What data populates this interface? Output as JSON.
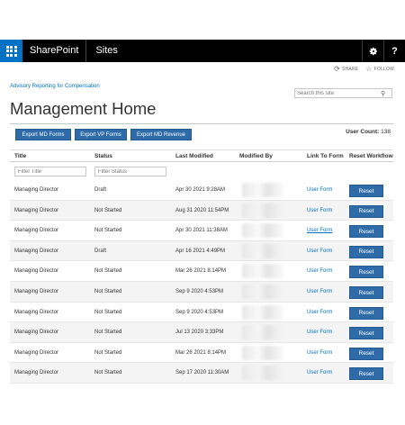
{
  "suitebar": {
    "brand": "SharePoint",
    "sites": "Sites",
    "gear_icon": "gear-icon",
    "help_label": "?"
  },
  "actions": {
    "share": "SHARE",
    "follow": "FOLLOW"
  },
  "site_link": "Advisory Reporting for Compensation",
  "search": {
    "placeholder": "Search this site"
  },
  "page_title": "Management Home",
  "buttons": {
    "export_md": "Export MD Forms",
    "export_vp": "Export VP Forms",
    "export_rev": "Export MD Revenue"
  },
  "user_count": {
    "label": "User Count:",
    "value": "138"
  },
  "columns": {
    "title": "Title",
    "status": "Status",
    "modified": "Last Modified",
    "modified_by": "Modified By",
    "link": "Link To Form",
    "reset": "Reset Workflow"
  },
  "filters": {
    "title": "Filter Title",
    "status": "Filter Status"
  },
  "rows": [
    {
      "title": "Managing Director",
      "status": "Draft",
      "modified": "Apr 30 2021 9:28AM",
      "link": "User Form",
      "reset": "Reset"
    },
    {
      "title": "Managing Director",
      "status": "Not Started",
      "modified": "Aug 31 2020 11:54PM",
      "link": "User Form",
      "reset": "Reset"
    },
    {
      "title": "Managing Director",
      "status": "Not Started",
      "modified": "Apr 30 2021 11:38AM",
      "link": "User Form",
      "reset": "Reset"
    },
    {
      "title": "Managing Director",
      "status": "Draft",
      "modified": "Apr 16 2021 4:49PM",
      "link": "User Form",
      "reset": "Reset"
    },
    {
      "title": "Managing Director",
      "status": "Not Started",
      "modified": "Mar 26 2021 8:14PM",
      "link": "User Form",
      "reset": "Reset"
    },
    {
      "title": "Managing Director",
      "status": "Not Started",
      "modified": "Sep 9 2020 4:53PM",
      "link": "User Form",
      "reset": "Reset"
    },
    {
      "title": "Managing Director",
      "status": "Not Started",
      "modified": "Sep 9 2020 4:53PM",
      "link": "User Form",
      "reset": "Reset"
    },
    {
      "title": "Managing Director",
      "status": "Not Started",
      "modified": "Jul 13 2020 3:33PM",
      "link": "User Form",
      "reset": "Reset"
    },
    {
      "title": "Managing Director",
      "status": "Not Started",
      "modified": "Mar 26 2021 8:14PM",
      "link": "User Form",
      "reset": "Reset"
    },
    {
      "title": "Managing Director",
      "status": "Not Started",
      "modified": "Sep 17 2020 11:30AM",
      "link": "User Form",
      "reset": "Reset"
    }
  ],
  "colors": {
    "brand_blue": "#0072c6",
    "button_blue": "#2e6ba8",
    "suitebar": "#000000"
  }
}
